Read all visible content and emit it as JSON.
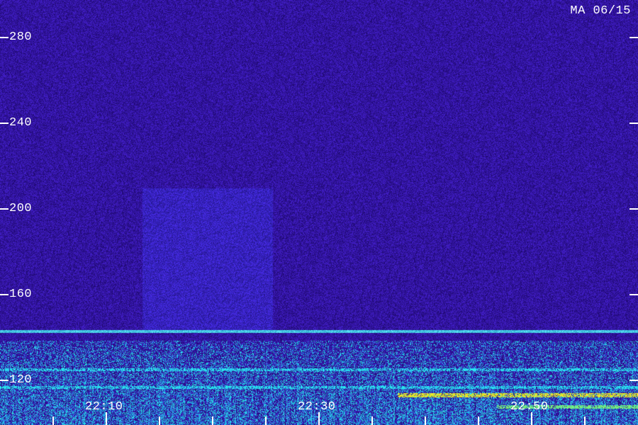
{
  "stamp": "MA 06/15",
  "axes": {
    "y_labels": [
      "280",
      "240",
      "200",
      "160",
      "120"
    ],
    "x_labels": [
      "22:10",
      "22:30",
      "22:50"
    ],
    "y_range": [
      108,
      290
    ],
    "x_tick_minutes": 5
  },
  "colors": {
    "background": "#1d0a6e",
    "axis": "#ffffff",
    "noise_low": "#2a0f8c",
    "noise_high": "#3b36d4",
    "signal_cyan": "#39d6ff",
    "signal_green": "#5cff8a",
    "signal_yellow": "#fff23a"
  }
}
